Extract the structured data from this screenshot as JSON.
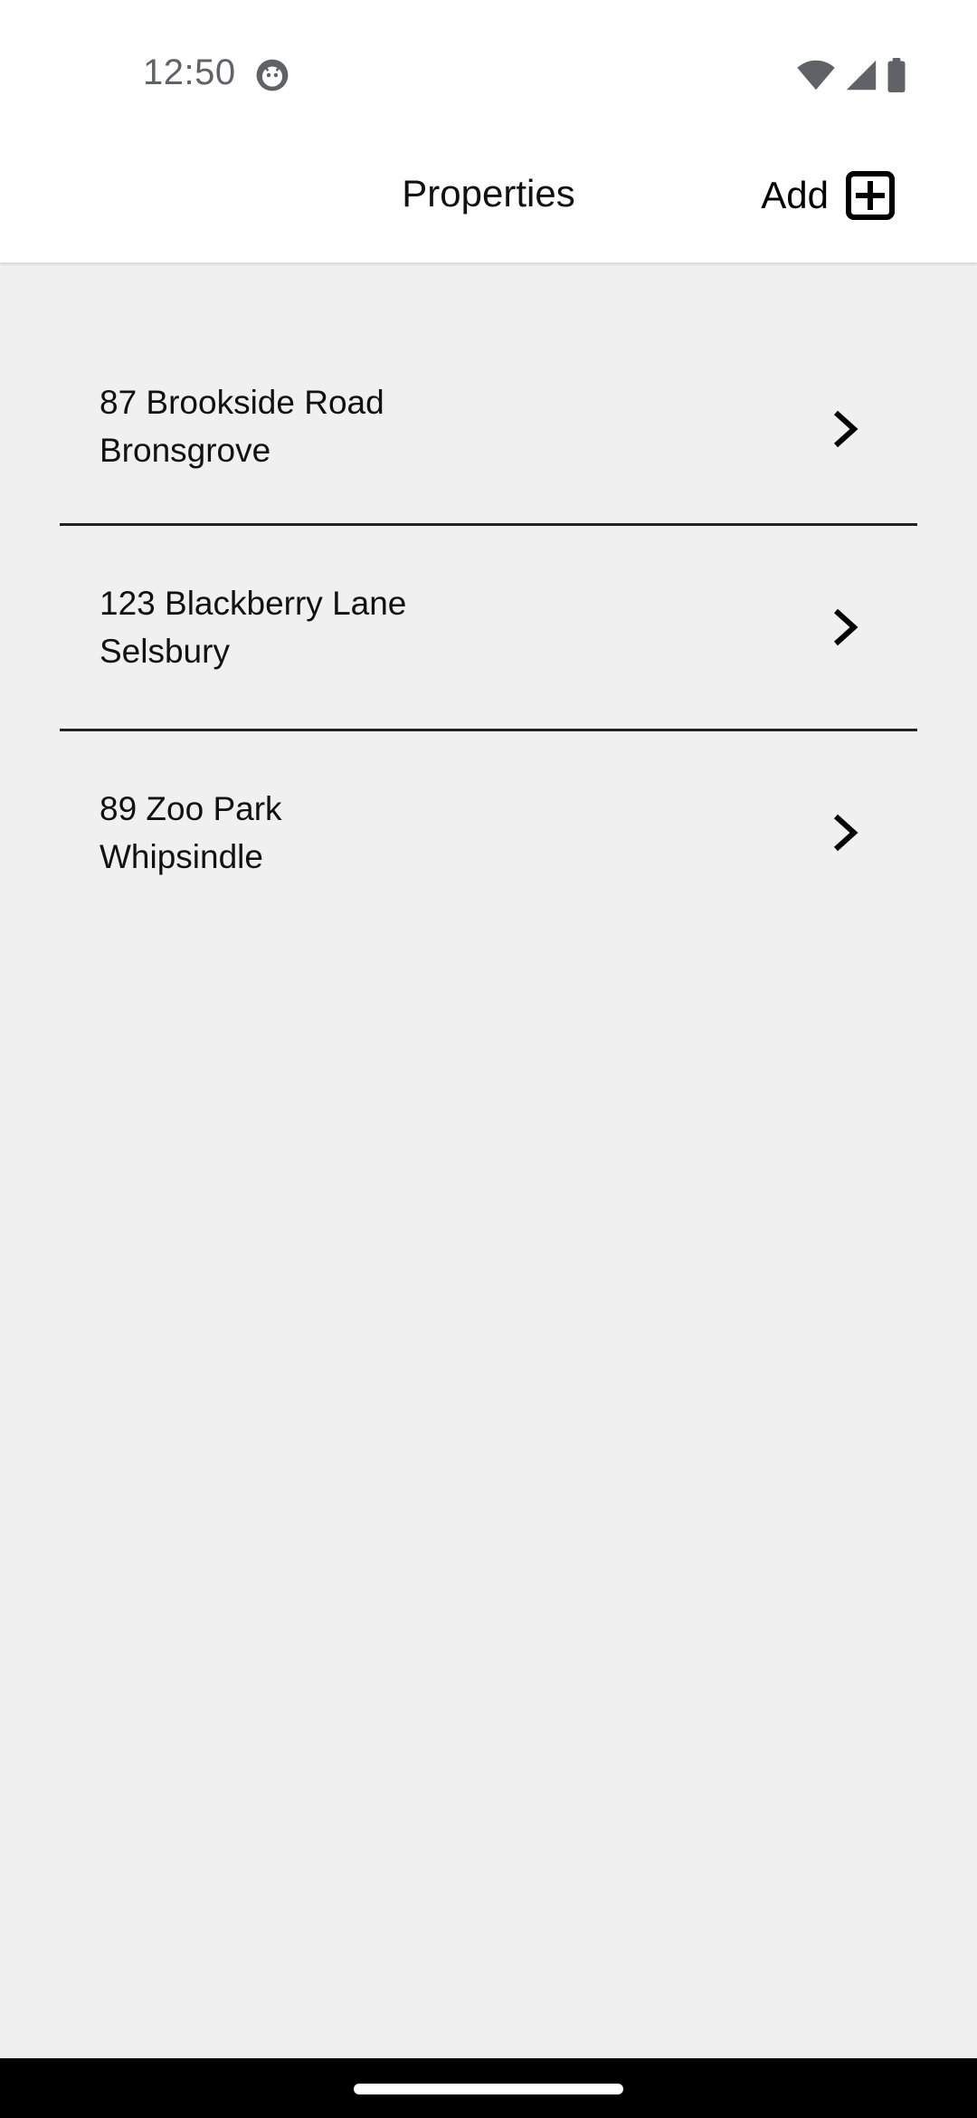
{
  "status_bar": {
    "time": "12:50",
    "icons": [
      "notification-icon",
      "wifi-icon",
      "cell-signal-icon",
      "battery-icon"
    ]
  },
  "header": {
    "title": "Properties",
    "add_label": "Add",
    "add_icon": "add-box-icon"
  },
  "properties": [
    {
      "line1": "87 Brookside Road",
      "line2": "Bronsgrove"
    },
    {
      "line1": "123 Blackberry Lane",
      "line2": "Selsbury"
    },
    {
      "line1": "89 Zoo Park",
      "line2": "Whipsindle"
    }
  ],
  "colors": {
    "background": "#f0f0f0",
    "header_background": "#ffffff",
    "text": "#111111",
    "status_text": "#5f6368",
    "nav_bar": "#000000"
  }
}
